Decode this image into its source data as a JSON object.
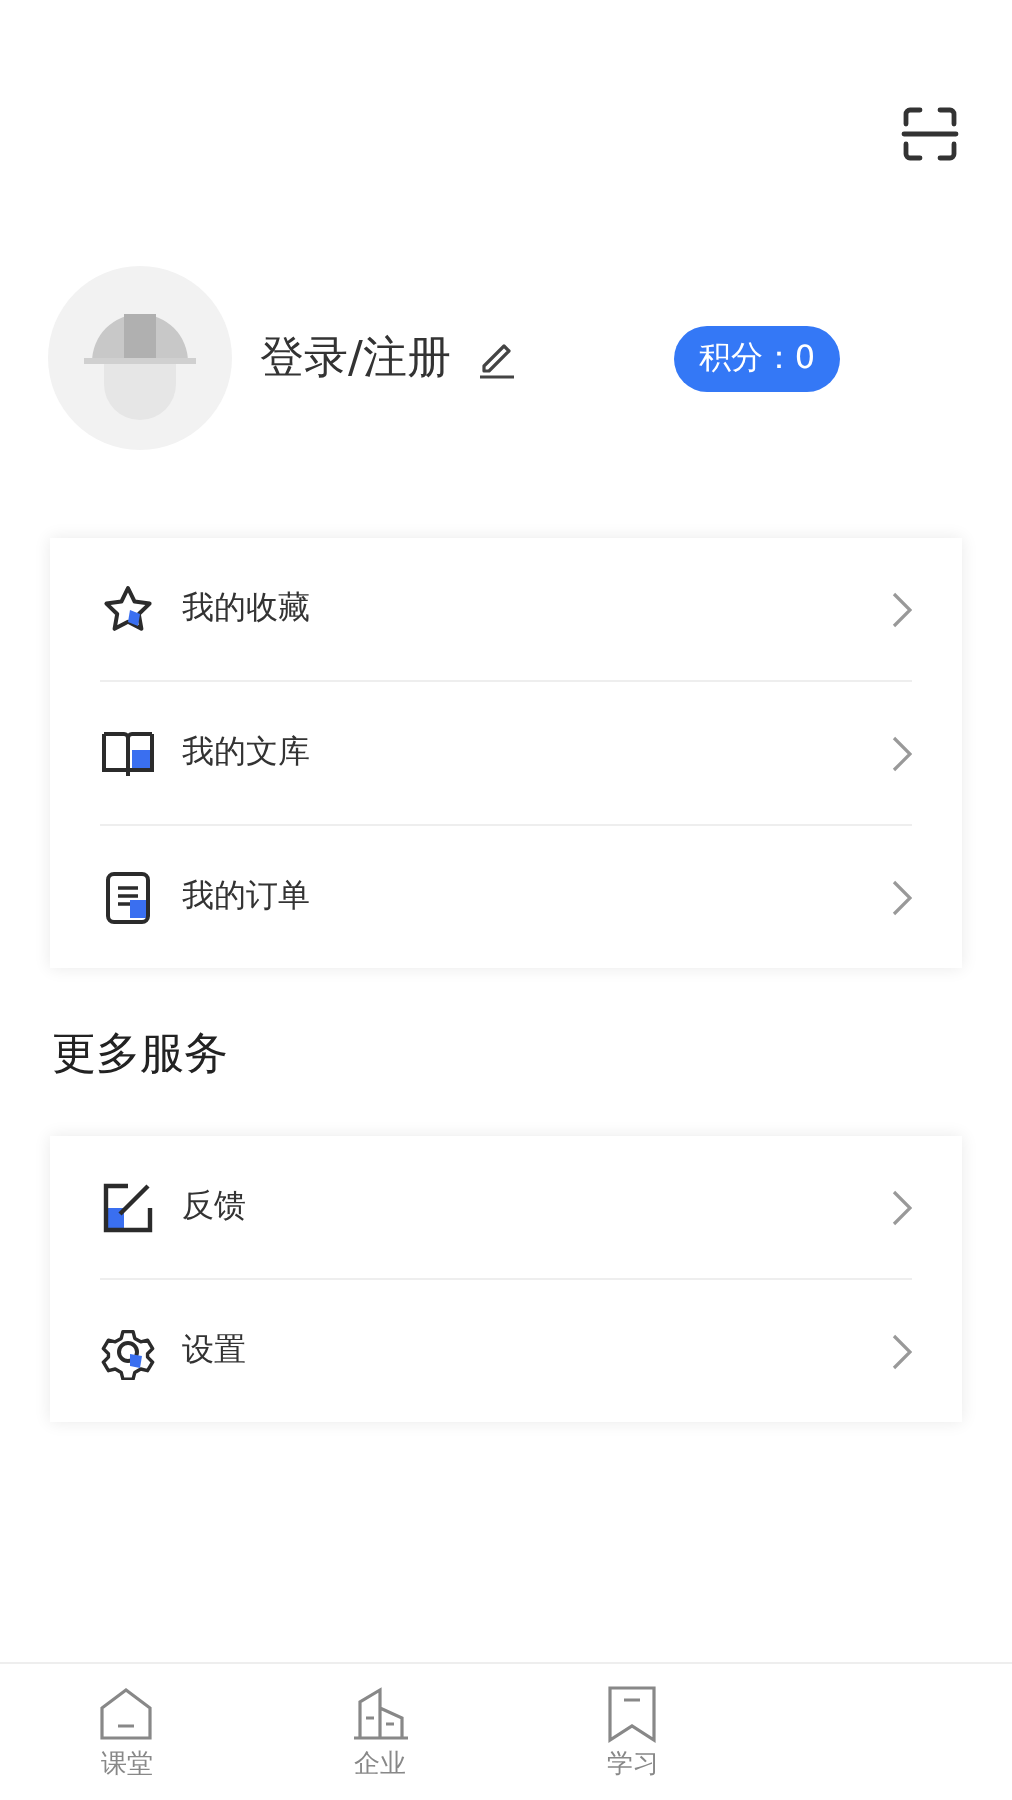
{
  "profile": {
    "name": "登录/注册",
    "points_badge": "积分：0"
  },
  "menu": [
    {
      "kind": "star",
      "label": "我的收藏"
    },
    {
      "kind": "book",
      "label": "我的文库"
    },
    {
      "kind": "order",
      "label": "我的订单"
    }
  ],
  "more_title": "更多服务",
  "services": [
    {
      "kind": "feedback",
      "label": "反馈"
    },
    {
      "kind": "settings",
      "label": "设置"
    }
  ],
  "tabs": [
    {
      "kind": "house",
      "label": "课堂",
      "selected": false
    },
    {
      "kind": "building",
      "label": "企业",
      "selected": false
    },
    {
      "kind": "bookmark",
      "label": "学习",
      "selected": false
    }
  ]
}
